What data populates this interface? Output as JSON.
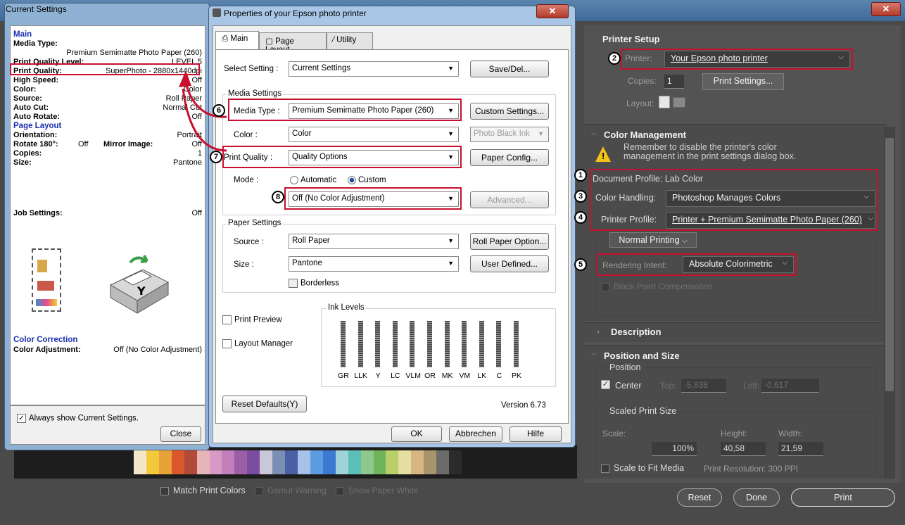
{
  "ps": {
    "preview_checks": [
      "Match Print Colors",
      "Gamut Warning",
      "Show Paper White"
    ],
    "swatches": [
      "#f2e7c8",
      "#f3c93a",
      "#e8a23a",
      "#d9572a",
      "#b24a3a",
      "#e7b4b8",
      "#d89ac4",
      "#c27fbb",
      "#9b5fa8",
      "#7b4da0",
      "#c8c8d8",
      "#7a8fb2",
      "#4a5fa4",
      "#a7c2e8",
      "#5d9ce0",
      "#3b7ad0",
      "#9ed3d8",
      "#5bbfb8",
      "#8ec88a",
      "#6fb45a",
      "#b9cf6a",
      "#e6dda0",
      "#d8b682",
      "#a8946a",
      "#6b6b6b",
      "#2b2b2b"
    ],
    "printer_setup": {
      "title": "Printer Setup",
      "printer_label": "Printer:",
      "printer_value": "Your Epson photo printer",
      "copies_label": "Copies:",
      "copies_value": "1",
      "print_settings_btn": "Print Settings...",
      "layout_label": "Layout:"
    },
    "color_management": {
      "title": "Color Management",
      "warning": "Remember to disable the printer's color management in the print settings dialog box.",
      "document_profile": "Document Profile: Lab Color",
      "color_handling_label": "Color Handling:",
      "color_handling_value": "Photoshop Manages Colors",
      "printer_profile_label": "Printer Profile:",
      "printer_profile_value": "Printer + Premium Semimatte Photo Paper (260)",
      "normal_printing": "Normal Printing",
      "rendering_intent_label": "Rendering Intent:",
      "rendering_intent_value": "Absolute Colorimetric",
      "black_point": "Black Point Compensation"
    },
    "description": {
      "title": "Description"
    },
    "position_size": {
      "title": "Position and Size",
      "position_label": "Position",
      "center_label": "Center",
      "top_label": "Top:",
      "top_value": "-5,838",
      "left_label": "Left:",
      "left_value": "-0,617",
      "scaled_label": "Scaled Print Size",
      "scale_label": "Scale:",
      "height_label": "Height:",
      "width_label": "Width:",
      "scale_value": "100%",
      "height_value": "40,58",
      "width_value": "21,59",
      "scale_fit": "Scale to Fit Media",
      "print_resolution": "Print Resolution: 300 PPI"
    },
    "buttons": {
      "reset": "Reset",
      "done": "Done",
      "print": "Print"
    }
  },
  "current_settings": {
    "title": "Current Settings",
    "main_heading": "Main",
    "media_type_label": "Media Type:",
    "media_type_value": "Premium Semimatte Photo Paper (260)",
    "rows": [
      {
        "k": "Print Quality Level:",
        "v": "LEVEL 5"
      },
      {
        "k": "Print Quality:",
        "v": "SuperPhoto - 2880x1440dpi"
      },
      {
        "k": "High Speed:",
        "v": "Off"
      },
      {
        "k": "Color:",
        "v": "Color"
      },
      {
        "k": "Source:",
        "v": "Roll Paper"
      },
      {
        "k": "Auto Cut:",
        "v": "Normal Cut"
      },
      {
        "k": "Auto Rotate:",
        "v": "Off"
      }
    ],
    "page_layout_heading": "Page Layout",
    "orientation_label": "Orientation:",
    "orientation_value": "Portrait",
    "rotate_label": "Rotate 180°:",
    "rotate_value": "Off",
    "mirror_label": "Mirror Image:",
    "mirror_value": "Off",
    "copies_label": "Copies:",
    "copies_value": "1",
    "size_label": "Size:",
    "size_value": "Pantone",
    "job_settings_label": "Job Settings:",
    "job_settings_value": "Off",
    "color_correction_heading": "Color Correction",
    "color_adjustment_label": "Color Adjustment:",
    "color_adjustment_value": "Off (No Color Adjustment)",
    "always_show": "Always show Current Settings.",
    "close_btn": "Close"
  },
  "epson": {
    "title": "Properties of your Epson photo printer",
    "tabs": [
      "Main",
      "Page Layout",
      "Utility"
    ],
    "select_setting_label": "Select Setting :",
    "select_setting_value": "Current Settings",
    "save_del": "Save/Del...",
    "media_settings": "Media Settings",
    "media_type_label": "Media Type :",
    "media_type_value": "Premium Semimatte Photo Paper (260)",
    "custom_settings": "Custom Settings...",
    "color_label": "Color :",
    "color_value": "Color",
    "photo_black_ink": "Photo Black Ink",
    "print_quality_label": "Print Quality :",
    "print_quality_value": "Quality Options",
    "paper_config": "Paper Config...",
    "mode_label": "Mode :",
    "mode_automatic": "Automatic",
    "mode_custom": "Custom",
    "mode_value": "Off (No Color Adjustment)",
    "advanced": "Advanced...",
    "paper_settings": "Paper Settings",
    "source_label": "Source :",
    "source_value": "Roll Paper",
    "roll_paper_option": "Roll Paper Option...",
    "size_label": "Size :",
    "size_value": "Pantone",
    "user_defined": "User Defined...",
    "borderless": "Borderless",
    "print_preview": "Print Preview",
    "layout_manager": "Layout Manager",
    "ink_levels": "Ink Levels",
    "inks": [
      "GR",
      "LLK",
      "Y",
      "LC",
      "VLM",
      "OR",
      "MK",
      "VM",
      "LK",
      "C",
      "PK"
    ],
    "reset_defaults": "Reset Defaults(Y)",
    "version": "Version 6.73",
    "ok": "OK",
    "cancel": "Abbrechen",
    "help": "Hilfe"
  },
  "callouts": [
    "1",
    "2",
    "3",
    "4",
    "5",
    "6",
    "7",
    "8"
  ]
}
